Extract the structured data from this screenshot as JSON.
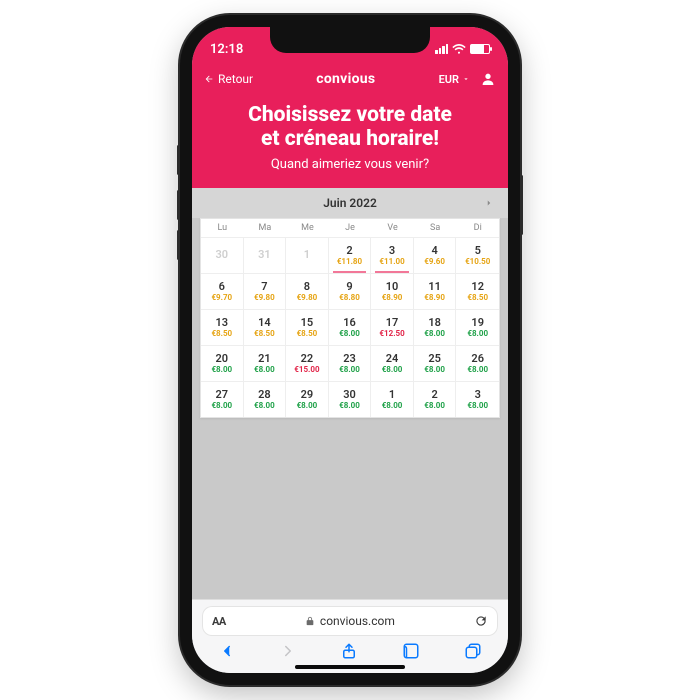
{
  "status": {
    "time": "12:18"
  },
  "topbar": {
    "back_label": "Retour",
    "brand": "convious",
    "currency_label": "EUR"
  },
  "hero": {
    "title_line1": "Choisissez votre date",
    "title_line2": "et créneau horaire!",
    "subtitle": "Quand aimeriez vous venir?"
  },
  "calendar": {
    "month_label": "Juin 2022",
    "weekdays": [
      "Lu",
      "Ma",
      "Me",
      "Je",
      "Ve",
      "Sa",
      "Di"
    ],
    "cells": [
      {
        "day": "30",
        "price": "",
        "cls": "muted"
      },
      {
        "day": "31",
        "price": "",
        "cls": "muted"
      },
      {
        "day": "1",
        "price": "",
        "cls": "muted"
      },
      {
        "day": "2",
        "price": "€11.80",
        "pcls": "p-orange",
        "under": true
      },
      {
        "day": "3",
        "price": "€11.00",
        "pcls": "p-orange",
        "under": true
      },
      {
        "day": "4",
        "price": "€9.60",
        "pcls": "p-orange"
      },
      {
        "day": "5",
        "price": "€10.50",
        "pcls": "p-orange"
      },
      {
        "day": "6",
        "price": "€9.70",
        "pcls": "p-orange"
      },
      {
        "day": "7",
        "price": "€9.80",
        "pcls": "p-orange"
      },
      {
        "day": "8",
        "price": "€9.80",
        "pcls": "p-orange"
      },
      {
        "day": "9",
        "price": "€8.80",
        "pcls": "p-orange"
      },
      {
        "day": "10",
        "price": "€8.90",
        "pcls": "p-orange"
      },
      {
        "day": "11",
        "price": "€8.90",
        "pcls": "p-orange"
      },
      {
        "day": "12",
        "price": "€8.50",
        "pcls": "p-orange"
      },
      {
        "day": "13",
        "price": "€8.50",
        "pcls": "p-orange"
      },
      {
        "day": "14",
        "price": "€8.50",
        "pcls": "p-orange"
      },
      {
        "day": "15",
        "price": "€8.50",
        "pcls": "p-orange"
      },
      {
        "day": "16",
        "price": "€8.00",
        "pcls": "p-green"
      },
      {
        "day": "17",
        "price": "€12.50",
        "pcls": "p-red"
      },
      {
        "day": "18",
        "price": "€8.00",
        "pcls": "p-green"
      },
      {
        "day": "19",
        "price": "€8.00",
        "pcls": "p-green"
      },
      {
        "day": "20",
        "price": "€8.00",
        "pcls": "p-green"
      },
      {
        "day": "21",
        "price": "€8.00",
        "pcls": "p-green"
      },
      {
        "day": "22",
        "price": "€15.00",
        "pcls": "p-red"
      },
      {
        "day": "23",
        "price": "€8.00",
        "pcls": "p-green"
      },
      {
        "day": "24",
        "price": "€8.00",
        "pcls": "p-green"
      },
      {
        "day": "25",
        "price": "€8.00",
        "pcls": "p-green"
      },
      {
        "day": "26",
        "price": "€8.00",
        "pcls": "p-green"
      },
      {
        "day": "27",
        "price": "€8.00",
        "pcls": "p-green"
      },
      {
        "day": "28",
        "price": "€8.00",
        "pcls": "p-green"
      },
      {
        "day": "29",
        "price": "€8.00",
        "pcls": "p-green"
      },
      {
        "day": "30",
        "price": "€8.00",
        "pcls": "p-green"
      },
      {
        "day": "1",
        "price": "€8.00",
        "pcls": "p-green"
      },
      {
        "day": "2",
        "price": "€8.00",
        "pcls": "p-green"
      },
      {
        "day": "3",
        "price": "€8.00",
        "pcls": "p-green"
      }
    ]
  },
  "browser": {
    "aa_label": "AA",
    "domain": "convious.com"
  }
}
